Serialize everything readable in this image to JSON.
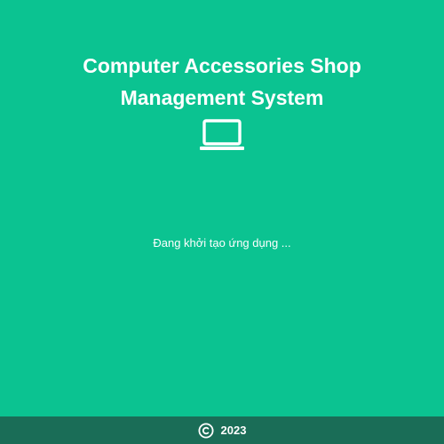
{
  "app": {
    "title_line1": "Computer Accessories Shop",
    "title_line2": "Management System",
    "icon": "laptop-icon"
  },
  "status": {
    "text": "Đang khởi tạo ứng dụng ..."
  },
  "footer": {
    "icon": "copyright-icon",
    "year": "2023"
  },
  "colors": {
    "background": "#0bc391",
    "footer": "#1a6d57",
    "text": "#ffffff"
  }
}
